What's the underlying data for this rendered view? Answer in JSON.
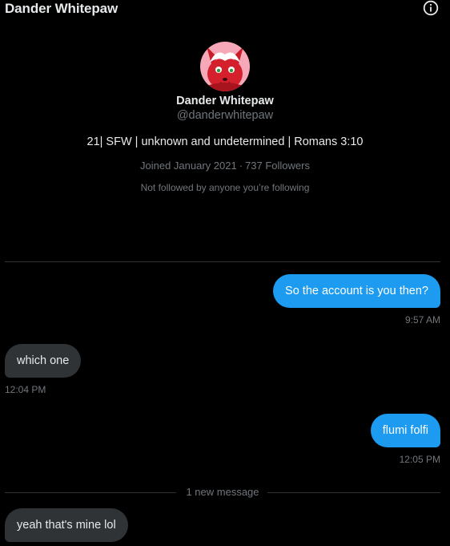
{
  "header": {
    "title": "Dander Whitepaw",
    "info_icon": "info-circle-icon"
  },
  "profile": {
    "avatar": "red-wolf-avatar",
    "display_name": "Dander Whitepaw",
    "handle": "@danderwhitepaw",
    "bio": "21| SFW | unknown and undetermined | Romans 3:10",
    "joined": "Joined January 2021",
    "separator": "·",
    "followers": "737 Followers",
    "not_followed": "Not followed by anyone you’re following"
  },
  "messages": [
    {
      "direction": "sent",
      "text": "So the account is you then?",
      "time": "9:57 AM"
    },
    {
      "direction": "received",
      "text": "which one",
      "time": "12:04 PM"
    },
    {
      "direction": "sent",
      "text": "flumi folfi",
      "time": "12:05 PM"
    },
    {
      "direction": "received",
      "text": "yeah that's mine lol",
      "time": ""
    }
  ],
  "new_message_divider": "1 new message",
  "colors": {
    "background": "#000000",
    "sent_bubble": "#1d9bf0",
    "received_bubble": "#2f3336",
    "secondary_text": "#71767b",
    "primary_text": "#e7e9ea",
    "avatar_background": "#f7a8b8"
  }
}
